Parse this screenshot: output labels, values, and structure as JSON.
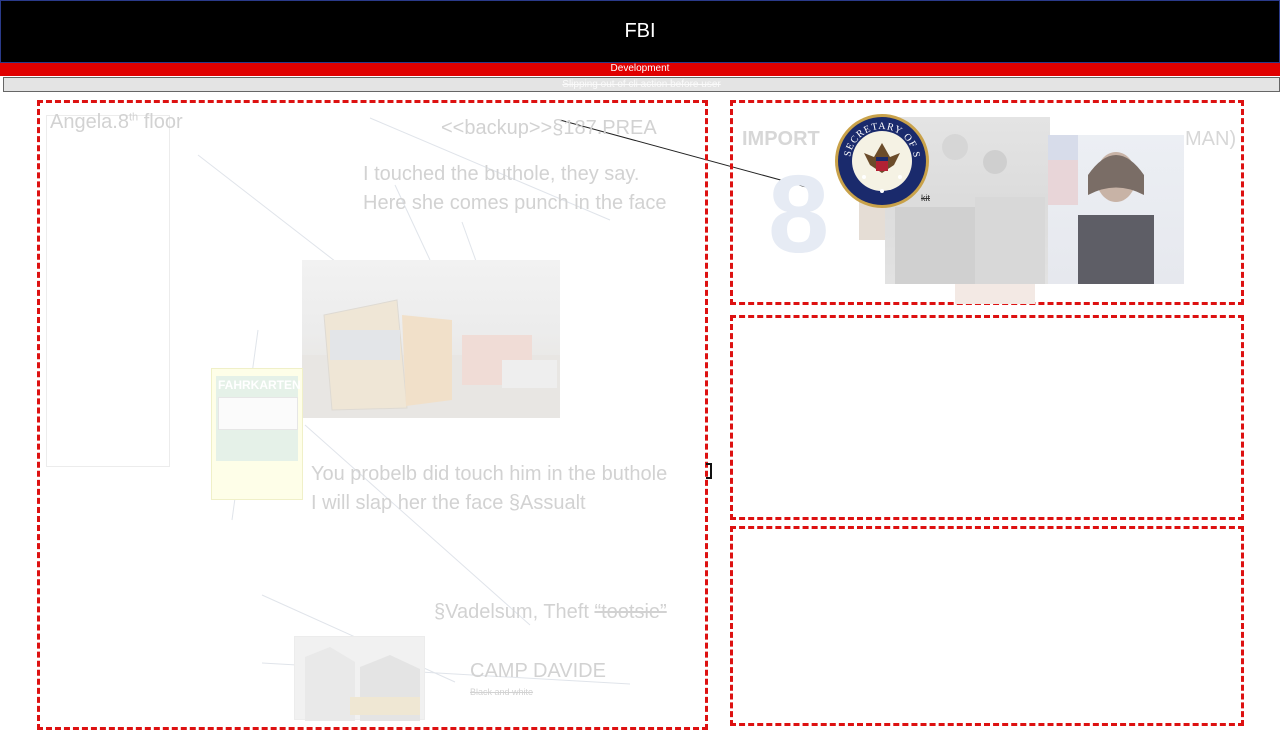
{
  "header": {
    "title": "FBI",
    "subtitle": "Development",
    "banner": "Slipping out of cli action before user"
  },
  "left": {
    "angela_prefix": "Angela.8",
    "angela_sup": "th",
    "angela_suffix": " floor",
    "backup": "<<backup>>§187.PREA",
    "quote1_line1": "I touched the buthole, they say.",
    "quote1_line2": "Here she comes punch in the face",
    "ticket_label": "FAHRKARTEN",
    "quote2_line1": "You probelb did touch him in the buthole",
    "quote2_line2": "I will slap her the face  §Assualt",
    "vandalism_prefix": "§Vadelsum, Theft ",
    "vandalism_strike": "“tootsie”",
    "camp": "CAMP DAVIDE",
    "camp_sub": "Black and white"
  },
  "right": {
    "import_text": "IMPORT",
    "tail_text": "MAN)",
    "digit": "8",
    "x_mark": "x",
    "seal_text": "SECRETARY OF STATE",
    "kit": "kit"
  },
  "colors": {
    "accent_red": "#dd1111",
    "header_bg": "#000000",
    "dev_bar": "#e00000"
  }
}
